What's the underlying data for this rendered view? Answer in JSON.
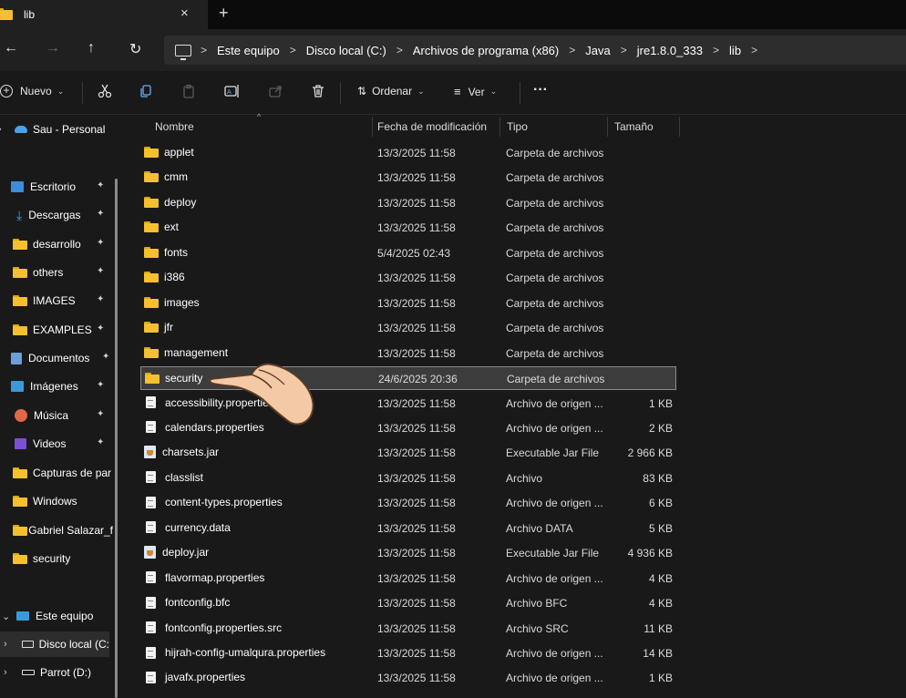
{
  "tab": {
    "title": "lib",
    "close_glyph": "×",
    "new_glyph": "+"
  },
  "nav": {
    "back_glyph": "←",
    "forward_glyph": "→",
    "up_glyph": "↑",
    "refresh_glyph": "↻",
    "breadcrumbs": [
      "Este equipo",
      "Disco local (C:)",
      "Archivos de programa (x86)",
      "Java",
      "jre1.8.0_333",
      "lib"
    ],
    "separator": ">"
  },
  "toolbar": {
    "new_label": "Nuevo",
    "sort_label": "Ordenar",
    "view_label": "Ver",
    "more_glyph": "···"
  },
  "sidebar": {
    "items": [
      {
        "label": "Sau - Personal",
        "icon": "cloud-icon",
        "color": "#4aa3e8"
      },
      {
        "label": "Escritorio",
        "icon": "desktop-icon",
        "color": "#3b8ede",
        "pinned": true
      },
      {
        "label": "Descargas",
        "icon": "download-icon",
        "color": "#3fa8e6",
        "pinned": true
      },
      {
        "label": "desarrollo",
        "icon": "folder-icon",
        "pinned": true
      },
      {
        "label": "others",
        "icon": "folder-icon",
        "pinned": true
      },
      {
        "label": "IMAGES",
        "icon": "folder-icon",
        "pinned": true
      },
      {
        "label": "EXAMPLES",
        "icon": "folder-icon",
        "pinned": true
      },
      {
        "label": "Documentos",
        "icon": "documents-icon",
        "color": "#6a9fd8",
        "pinned": true
      },
      {
        "label": "Imágenes",
        "icon": "pictures-icon",
        "color": "#3a9ad9",
        "pinned": true
      },
      {
        "label": "Música",
        "icon": "music-icon",
        "color": "#e0674a",
        "pinned": true
      },
      {
        "label": "Videos",
        "icon": "videos-icon",
        "color": "#7b4fd6",
        "pinned": true
      },
      {
        "label": "Capturas de par",
        "icon": "folder-icon"
      },
      {
        "label": "Windows",
        "icon": "folder-icon"
      },
      {
        "label": "Gabriel Salazar_f",
        "icon": "folder-icon"
      },
      {
        "label": "security",
        "icon": "folder-icon"
      },
      {
        "label": "Este equipo",
        "icon": "pc-icon",
        "color": "#3a9ad9"
      },
      {
        "label": "Disco local (C:",
        "icon": "drive-icon"
      },
      {
        "label": "Parrot (D:)",
        "icon": "drive-icon"
      }
    ],
    "pin_glyph": "📌"
  },
  "columns": {
    "name": "Nombre",
    "date": "Fecha de modificación",
    "type": "Tipo",
    "size": "Tamaño"
  },
  "files": [
    {
      "name": "applet",
      "date": "13/3/2025 11:58",
      "type": "Carpeta de archivos",
      "size": "",
      "kind": "folder"
    },
    {
      "name": "cmm",
      "date": "13/3/2025 11:58",
      "type": "Carpeta de archivos",
      "size": "",
      "kind": "folder"
    },
    {
      "name": "deploy",
      "date": "13/3/2025 11:58",
      "type": "Carpeta de archivos",
      "size": "",
      "kind": "folder"
    },
    {
      "name": "ext",
      "date": "13/3/2025 11:58",
      "type": "Carpeta de archivos",
      "size": "",
      "kind": "folder"
    },
    {
      "name": "fonts",
      "date": "5/4/2025 02:43",
      "type": "Carpeta de archivos",
      "size": "",
      "kind": "folder"
    },
    {
      "name": "i386",
      "date": "13/3/2025 11:58",
      "type": "Carpeta de archivos",
      "size": "",
      "kind": "folder"
    },
    {
      "name": "images",
      "date": "13/3/2025 11:58",
      "type": "Carpeta de archivos",
      "size": "",
      "kind": "folder"
    },
    {
      "name": "jfr",
      "date": "13/3/2025 11:58",
      "type": "Carpeta de archivos",
      "size": "",
      "kind": "folder"
    },
    {
      "name": "management",
      "date": "13/3/2025 11:58",
      "type": "Carpeta de archivos",
      "size": "",
      "kind": "folder"
    },
    {
      "name": "security",
      "date": "24/6/2025 20:36",
      "type": "Carpeta de archivos",
      "size": "",
      "kind": "folder",
      "selected": true
    },
    {
      "name": "accessibility.properties",
      "date": "13/3/2025 11:58",
      "type": "Archivo de origen ...",
      "size": "1 KB",
      "kind": "file"
    },
    {
      "name": "calendars.properties",
      "date": "13/3/2025 11:58",
      "type": "Archivo de origen ...",
      "size": "2 KB",
      "kind": "file"
    },
    {
      "name": "charsets.jar",
      "date": "13/3/2025 11:58",
      "type": "Executable Jar File",
      "size": "2 966 KB",
      "kind": "jar"
    },
    {
      "name": "classlist",
      "date": "13/3/2025 11:58",
      "type": "Archivo",
      "size": "83 KB",
      "kind": "file"
    },
    {
      "name": "content-types.properties",
      "date": "13/3/2025 11:58",
      "type": "Archivo de origen ...",
      "size": "6 KB",
      "kind": "file"
    },
    {
      "name": "currency.data",
      "date": "13/3/2025 11:58",
      "type": "Archivo DATA",
      "size": "5 KB",
      "kind": "file"
    },
    {
      "name": "deploy.jar",
      "date": "13/3/2025 11:58",
      "type": "Executable Jar File",
      "size": "4 936 KB",
      "kind": "jar"
    },
    {
      "name": "flavormap.properties",
      "date": "13/3/2025 11:58",
      "type": "Archivo de origen ...",
      "size": "4 KB",
      "kind": "file"
    },
    {
      "name": "fontconfig.bfc",
      "date": "13/3/2025 11:58",
      "type": "Archivo BFC",
      "size": "4 KB",
      "kind": "file"
    },
    {
      "name": "fontconfig.properties.src",
      "date": "13/3/2025 11:58",
      "type": "Archivo SRC",
      "size": "11 KB",
      "kind": "file"
    },
    {
      "name": "hijrah-config-umalqura.properties",
      "date": "13/3/2025 11:58",
      "type": "Archivo de origen ...",
      "size": "14 KB",
      "kind": "file"
    },
    {
      "name": "javafx.properties",
      "date": "13/3/2025 11:58",
      "type": "Archivo de origen ...",
      "size": "1 KB",
      "kind": "file"
    }
  ]
}
